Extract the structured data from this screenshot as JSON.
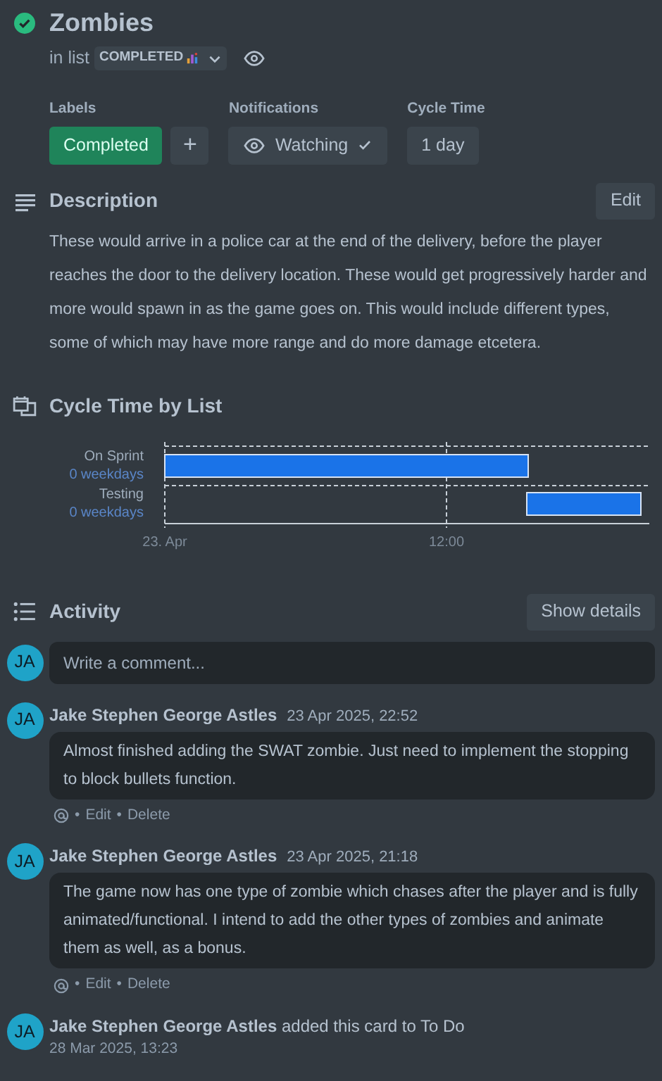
{
  "card": {
    "title": "Zombies",
    "completed": true,
    "list_prefix": "in list",
    "list_name": "COMPLETED"
  },
  "fields": {
    "labels": {
      "heading": "Labels",
      "items": [
        {
          "text": "Completed",
          "color": "#1f845a"
        }
      ],
      "add": "+"
    },
    "notifications": {
      "heading": "Notifications",
      "button": "Watching",
      "watching": true
    },
    "cycle_time": {
      "heading": "Cycle Time",
      "value": "1 day"
    }
  },
  "description": {
    "heading": "Description",
    "edit": "Edit",
    "text": "These would arrive in a police car at the end of the delivery, before the player reaches the door to the delivery location. These would get progressively harder and more would spawn in as the game goes on. This would include different types, some of which may have more range and do more damage etcetera."
  },
  "cycle_chart": {
    "heading": "Cycle Time by List",
    "rows": [
      {
        "name": "On Sprint",
        "note": "0 weekdays"
      },
      {
        "name": "Testing",
        "note": "0 weekdays"
      }
    ],
    "axis_labels": [
      "23. Apr",
      "12:00"
    ]
  },
  "activity": {
    "heading": "Activity",
    "show_details": "Show details",
    "comment_placeholder": "Write a comment...",
    "avatar": "JA",
    "separator": "•",
    "items": [
      {
        "kind": "comment",
        "avatar": "JA",
        "author": "Jake Stephen George Astles",
        "time": "23 Apr 2025, 22:52",
        "text": "Almost finished adding the SWAT zombie. Just need to implement the stopping to block bullets function.",
        "actions": [
          "Edit",
          "Delete"
        ]
      },
      {
        "kind": "comment",
        "avatar": "JA",
        "author": "Jake Stephen George Astles",
        "time": "23 Apr 2025, 21:18",
        "text": "The game now has one type of zombie which chases after the player and is fully animated/functional. I intend to add the other types of zombies and animate them as well, as a bonus.",
        "actions": [
          "Edit",
          "Delete"
        ]
      },
      {
        "kind": "action",
        "avatar": "JA",
        "author": "Jake Stephen George Astles",
        "text": "added this card to To Do",
        "time": "28 Mar 2025, 13:23"
      }
    ]
  }
}
